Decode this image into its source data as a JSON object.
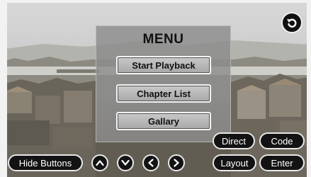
{
  "menu": {
    "title": "MENU",
    "items": [
      {
        "label": "Start Playback"
      },
      {
        "label": "Chapter List"
      },
      {
        "label": "Gallary"
      }
    ]
  },
  "controls": {
    "direct_label": "Direct",
    "code_label": "Code",
    "layout_label": "Layout",
    "enter_label": "Enter",
    "hide_buttons_label": "Hide Buttons"
  },
  "icons": {
    "back": "back-arrow-icon",
    "up": "caret-up-icon",
    "down": "caret-down-icon",
    "left": "caret-left-icon",
    "right": "caret-right-icon"
  }
}
